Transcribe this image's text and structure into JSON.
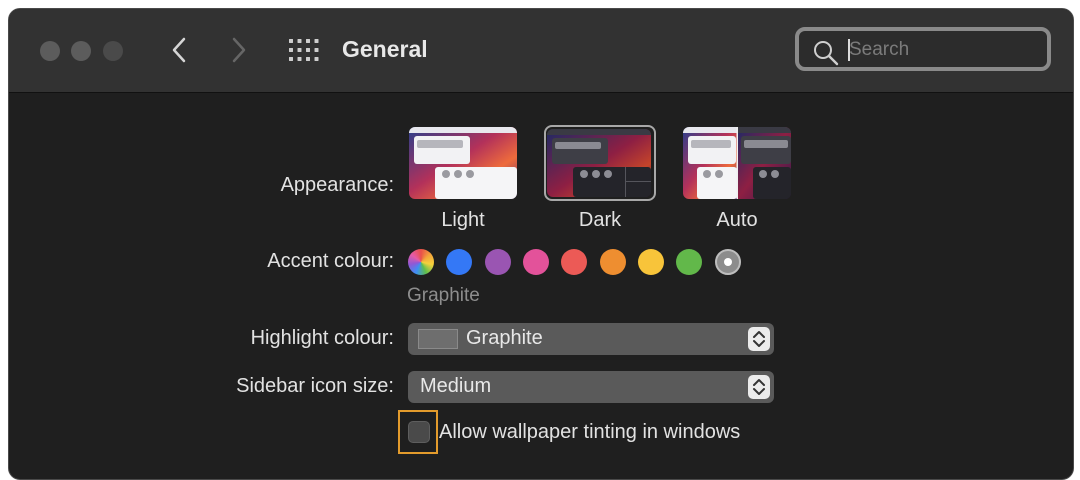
{
  "window": {
    "title": "General",
    "search": {
      "placeholder": "Search",
      "value": ""
    }
  },
  "appearance": {
    "label": "Appearance:",
    "options": [
      {
        "name": "Light",
        "selected": false
      },
      {
        "name": "Dark",
        "selected": true
      },
      {
        "name": "Auto",
        "selected": false
      }
    ]
  },
  "accent": {
    "label": "Accent colour:",
    "selected_name": "Graphite",
    "colors": [
      "multicolour",
      "#3478f6",
      "#9a55b2",
      "#e3529a",
      "#ec5a56",
      "#ee8e30",
      "#f8c43a",
      "#62b84a",
      "#8c8c8c"
    ]
  },
  "highlight": {
    "label": "Highlight colour:",
    "value": "Graphite"
  },
  "sidebar": {
    "label": "Sidebar icon size:",
    "value": "Medium"
  },
  "wallpaper_tinting": {
    "label": "Allow wallpaper tinting in windows",
    "checked": false
  }
}
